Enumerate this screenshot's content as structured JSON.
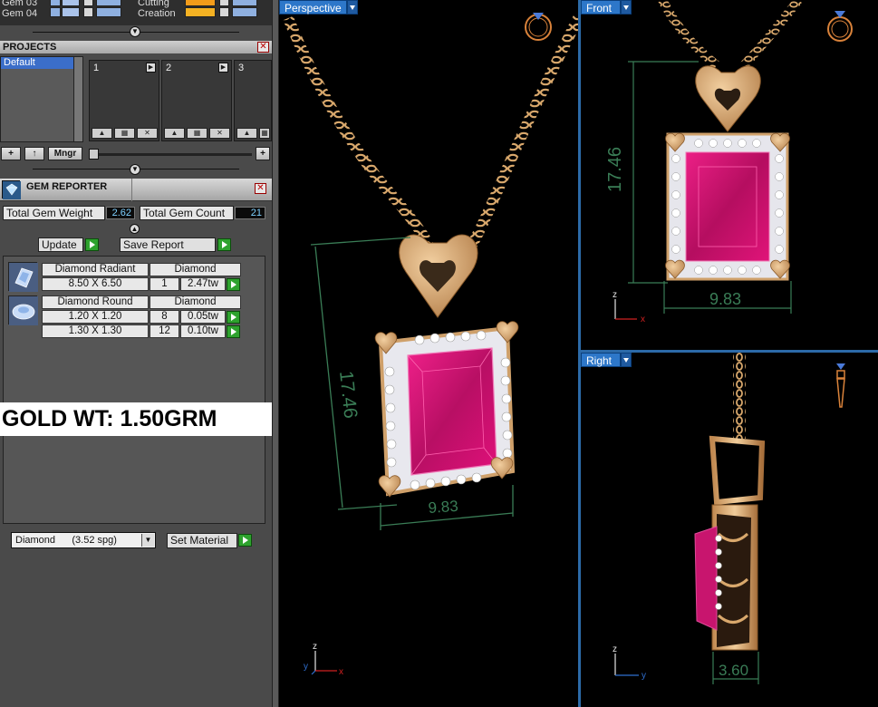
{
  "layers": {
    "rows": [
      {
        "label": "Gem 03",
        "right_label": "Cutting"
      },
      {
        "label": "Gem 04",
        "right_label": "Creation"
      }
    ]
  },
  "projects": {
    "title": "PROJECTS",
    "list": [
      "Default"
    ],
    "slots": [
      "1",
      "2",
      "3"
    ],
    "toolbar": {
      "add": "+",
      "up": "↑",
      "manager": "Mngr"
    },
    "zoom_plus": "+"
  },
  "gem_reporter": {
    "title": "GEM REPORTER",
    "total_weight_label": "Total Gem Weight",
    "total_weight_value": "2.62",
    "total_count_label": "Total Gem Count",
    "total_count_value": "21",
    "update_label": "Update",
    "save_label": "Save Report",
    "groups": [
      {
        "shape": "Diamond Radiant",
        "material": "Diamond",
        "rows": [
          {
            "size": "8.50 X 6.50",
            "count": "1",
            "weight": "2.47tw"
          }
        ]
      },
      {
        "shape": "Diamond Round",
        "material": "Diamond",
        "rows": [
          {
            "size": "1.20 X 1.20",
            "count": "8",
            "weight": "0.05tw"
          },
          {
            "size": "1.30 X 1.30",
            "count": "12",
            "weight": "0.10tw"
          }
        ]
      }
    ],
    "gold_weight_note": "GOLD WT: 1.50GRM",
    "material_select": "Diamond      (3.52 spg)",
    "set_material_label": "Set Material"
  },
  "viewports": {
    "perspective": {
      "label": "Perspective",
      "dim_height": "17.46",
      "dim_width": "9.83"
    },
    "front": {
      "label": "Front",
      "dim_height": "17.46",
      "dim_width": "9.83"
    },
    "right": {
      "label": "Right",
      "dim_depth": "3.60"
    }
  },
  "axes": {
    "x": "x",
    "y": "y",
    "z": "z"
  },
  "colors": {
    "gold": "#d9a86c",
    "ruby": "#c8156e",
    "viewport_tab": "#2d77c9",
    "dimension": "#3a7d56",
    "go_button": "#2ea22e"
  }
}
